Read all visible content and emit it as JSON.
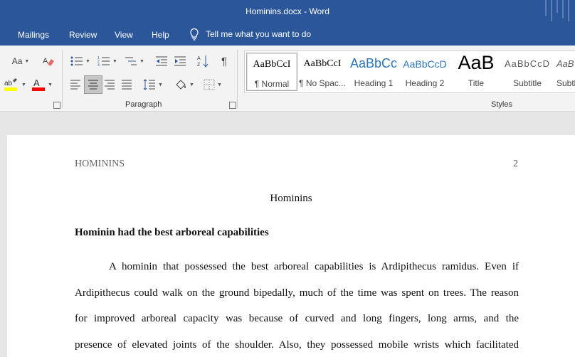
{
  "window": {
    "title": "Hominins.docx  -  Word"
  },
  "menu": {
    "items": [
      "Mailings",
      "Review",
      "View",
      "Help"
    ],
    "tell_me": "Tell me what you want to do"
  },
  "ribbon": {
    "font_group": {
      "change_case": "Aa"
    },
    "paragraph_label": "Paragraph",
    "styles_label": "Styles",
    "styles": [
      {
        "preview": "AaBbCcI",
        "name": "¶ Normal"
      },
      {
        "preview": "AaBbCcI",
        "name": "¶ No Spac..."
      },
      {
        "preview": "AaBbCc",
        "name": "Heading 1"
      },
      {
        "preview": "AaBbCcD",
        "name": "Heading 2"
      },
      {
        "preview": "AaB",
        "name": "Title"
      },
      {
        "preview": "AaBbCcD",
        "name": "Subtitle"
      },
      {
        "preview": "AaB",
        "name": "Subtl"
      }
    ],
    "colors": {
      "highlight": "#ffff00",
      "font_color": "#ff0000",
      "accent": "#2b579a"
    }
  },
  "document": {
    "header_left": "HOMININS",
    "header_right": "2",
    "title": "Hominins",
    "heading": "Hominin had the best arboreal capabilities",
    "lines": [
      "A hominin that possessed the best arboreal capabilities is Ardipithecus ramidus. Even if",
      "Ardipithecus could walk on the ground bipedally, much of the time was spent on trees. The reason",
      "for improved arboreal capacity was because of curved and long fingers, long arms, and the",
      "presence of elevated joints of the shoulder. Also, they possessed mobile wrists which facilitated"
    ]
  }
}
